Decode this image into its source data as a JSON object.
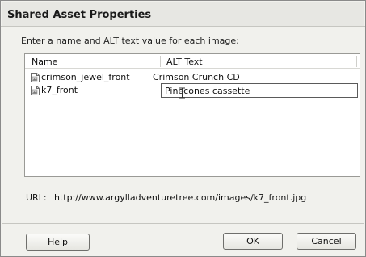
{
  "dialog": {
    "title": "Shared Asset Properties",
    "prompt": "Enter a name and ALT text value for each image:"
  },
  "list": {
    "columns": {
      "name": "Name",
      "alt": "ALT Text"
    },
    "rows": [
      {
        "name": "crimson_jewel_front",
        "alt": "Crimson Crunch CD",
        "icon": "image-file-icon"
      },
      {
        "name": "k7_front",
        "alt": "Pinecones cassette",
        "icon": "image-file-icon"
      }
    ]
  },
  "url": {
    "label": "URL:",
    "value": "http://www.argylladventuretree.com/images/k7_front.jpg"
  },
  "buttons": {
    "help": "Help",
    "ok": "OK",
    "cancel": "Cancel"
  }
}
